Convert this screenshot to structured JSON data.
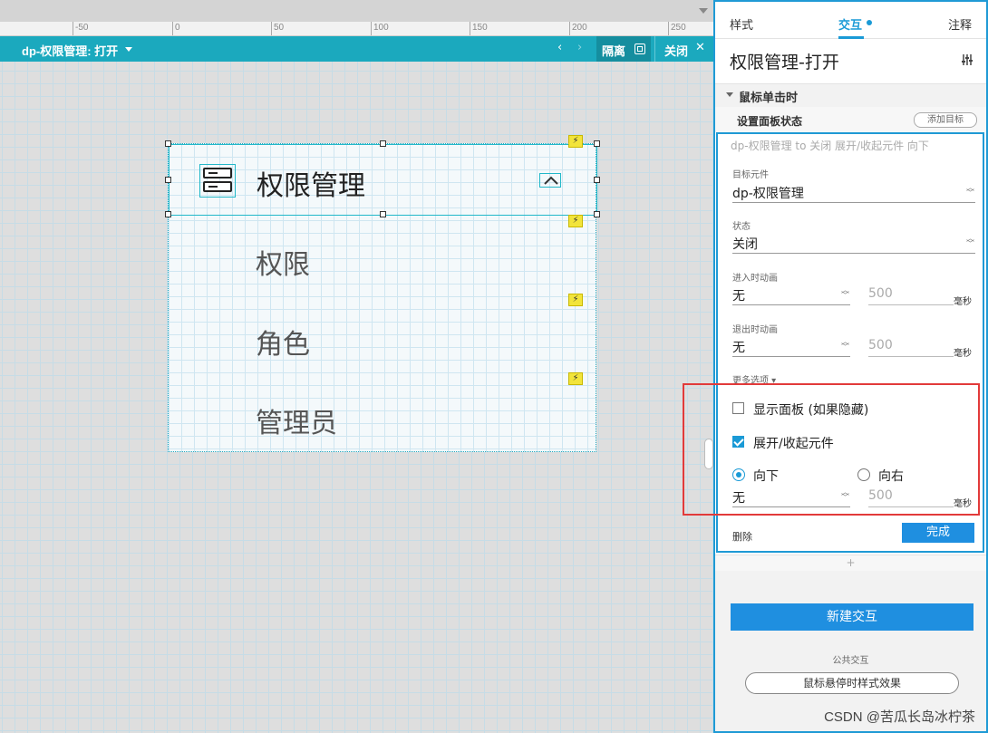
{
  "ruler": {
    "ticks": [
      "-50",
      "0",
      "50",
      "100",
      "150",
      "200",
      "250"
    ]
  },
  "tabbar": {
    "title": "dp-权限管理: 打开",
    "prev_icon": "‹",
    "next_icon": "›",
    "isolate_label": "隔离",
    "close_label": "关闭",
    "close_icon": "✕"
  },
  "widget": {
    "header_label": "权限管理",
    "bolt_glyph": "⚡",
    "items": [
      "权限",
      "角色",
      "管理员"
    ]
  },
  "panel": {
    "tabs": {
      "style": "样式",
      "interact": "交互",
      "notes": "注释"
    },
    "title": "权限管理-打开",
    "event": "鼠标单击时",
    "action": "设置面板状态",
    "add_target": "添加目标",
    "summary": "dp-权限管理 to 关闭 展开/收起元件 向下",
    "fields": {
      "target_label": "目标元件",
      "target_value": "dp-权限管理",
      "state_label": "状态",
      "state_value": "关闭",
      "enter_anim_label": "进入时动画",
      "enter_anim_value": "无",
      "enter_anim_ms": "500",
      "exit_anim_label": "退出时动画",
      "exit_anim_value": "无",
      "exit_anim_ms": "500",
      "unit": "毫秒"
    },
    "more_options": "更多选项 ▾",
    "options": {
      "show_panel": {
        "label": "显示面板 (如果隐藏)",
        "checked": false
      },
      "push_pull": {
        "label": "展开/收起元件",
        "checked": true
      },
      "direction_down": {
        "label": "向下",
        "selected": true
      },
      "direction_right": {
        "label": "向右",
        "selected": false
      },
      "anim_value": "无",
      "anim_ms": "500",
      "unit": "毫秒"
    },
    "delete": "删除",
    "done": "完成",
    "plus": "+",
    "new_interaction": "新建交互",
    "shared_label": "公共交互",
    "hover_style": "鼠标悬停时样式效果"
  },
  "watermark": "CSDN @苦瓜长岛冰柠茶",
  "colors": {
    "accent": "#1a9ad6",
    "tabbar": "#1ba9be",
    "highlight": "#e23a3a",
    "bolt": "#f2e43a"
  }
}
